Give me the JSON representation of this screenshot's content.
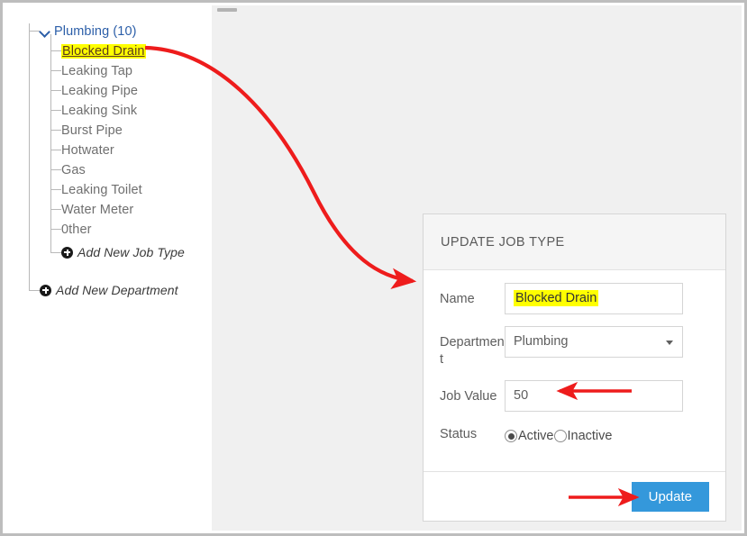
{
  "tree": {
    "root": {
      "label": "Plumbing (10)",
      "icon": "chevron-down-icon"
    },
    "items": [
      {
        "label": "Blocked Drain",
        "selected": true
      },
      {
        "label": "Leaking Tap",
        "selected": false
      },
      {
        "label": "Leaking Pipe",
        "selected": false
      },
      {
        "label": "Leaking Sink",
        "selected": false
      },
      {
        "label": "Burst Pipe",
        "selected": false
      },
      {
        "label": "Hotwater",
        "selected": false
      },
      {
        "label": "Gas",
        "selected": false
      },
      {
        "label": "Leaking Toilet",
        "selected": false
      },
      {
        "label": "Water Meter",
        "selected": false
      },
      {
        "label": "0ther",
        "selected": false
      }
    ],
    "add_job_type": {
      "label": "Add New Job Type",
      "icon": "plus-circle-icon"
    },
    "add_department": {
      "label": "Add New Department",
      "icon": "plus-circle-icon"
    }
  },
  "form": {
    "title": "UPDATE JOB TYPE",
    "name": {
      "label": "Name",
      "value": "Blocked Drain",
      "highlighted": true
    },
    "department": {
      "label": "Department",
      "value": "Plumbing",
      "arrow": "chevron-down-icon"
    },
    "job_value": {
      "label": "Job Value",
      "value": "50"
    },
    "status": {
      "label": "Status",
      "options": [
        {
          "label": "Active",
          "checked": true
        },
        {
          "label": "Inactive",
          "checked": false
        }
      ]
    },
    "submit_label": "Update"
  },
  "colors": {
    "accent_blue": "#3498db",
    "highlight_yellow": "#ffff00",
    "annotation_red": "#ee1c1c",
    "link_blue": "#2b5ea8",
    "work_area_gray": "#f0f0f0"
  }
}
